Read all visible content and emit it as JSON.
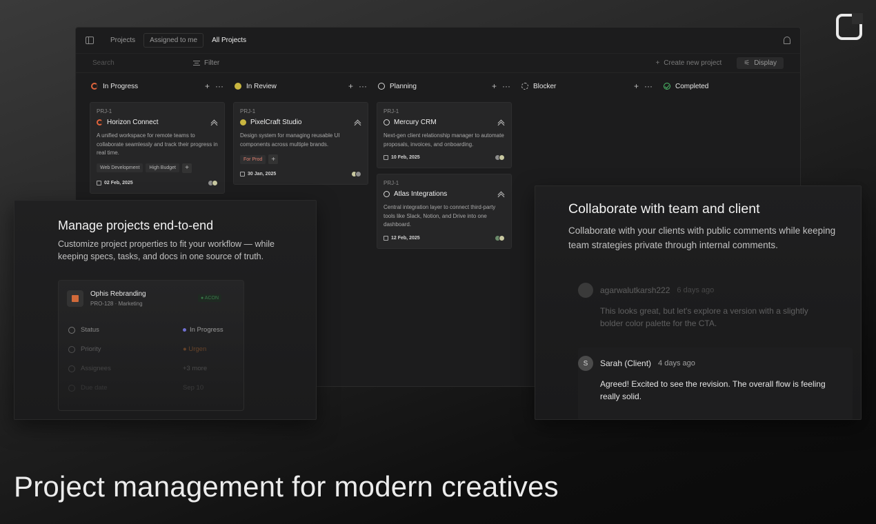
{
  "topbar": {
    "tabs": [
      {
        "label": "Projects"
      },
      {
        "label": "Assigned to me"
      },
      {
        "label": "All Projects"
      }
    ]
  },
  "filterbar": {
    "search_placeholder": "Search",
    "filter_label": "Filter",
    "create_label": "Create new project",
    "display_label": "Display"
  },
  "columns": [
    {
      "name": "In Progress",
      "status": "in-progress"
    },
    {
      "name": "In Review",
      "status": "in-review"
    },
    {
      "name": "Planning",
      "status": "planning"
    },
    {
      "name": "Blocker",
      "status": "blocker"
    },
    {
      "name": "Completed",
      "status": "completed"
    }
  ],
  "cards": {
    "horizon": {
      "id": "PRJ-1",
      "title": "Horizon Connect",
      "desc": "A unified workspace for remote teams to collaborate seamlessly and track their progress in real time.",
      "tags": [
        "Web Development",
        "High Budget"
      ],
      "date": "02 Feb, 2025"
    },
    "pixelcraft": {
      "id": "PRJ-1",
      "title": "PixelCraft Studio",
      "desc": "Design system for managing reusable UI components across multiple brands.",
      "tags": [
        "For Prod"
      ],
      "date": "30 Jan, 2025"
    },
    "mercury": {
      "id": "PRJ-1",
      "title": "Mercury CRM",
      "desc": "Next-gen client relationship manager to automate proposals, invoices, and onboarding.",
      "date": "10 Feb, 2025"
    },
    "atlas": {
      "id": "PRJ-1",
      "title": "Atlas Integrations",
      "desc": "Central integration layer to connect third-party tools like Slack, Notion, and Drive into one dashboard.",
      "date": "12 Feb, 2025"
    }
  },
  "left_panel": {
    "heading": "Manage projects end-to-end",
    "body": "Customize project properties to fit your workflow — while keeping specs, tasks, and docs in one source of truth.",
    "project": {
      "title": "Ophis Rebranding",
      "sub": "PRO-128 · Marketing",
      "badge": "● ACON",
      "props": [
        {
          "label": "Status",
          "value": "In Progress"
        },
        {
          "label": "Priority",
          "value": "● Urgen"
        },
        {
          "label": "Assignees",
          "value": "+3 more"
        },
        {
          "label": "Due date",
          "value": "Sep 10"
        }
      ]
    }
  },
  "right_panel": {
    "heading": "Collaborate with team and client",
    "body": "Collaborate with your clients with public comments while keeping team strategies private through internal comments.",
    "comments": [
      {
        "author": "agarwalutkarsh222",
        "time": "6 days ago",
        "text": "This looks great, but let's explore a version with a slightly bolder color palette for the CTA.",
        "initial": ""
      },
      {
        "author": "Sarah (Client)",
        "time": "4 days ago",
        "text": "Agreed! Excited to see the revision. The overall flow is feeling really solid.",
        "initial": "S"
      }
    ]
  },
  "headline": "Project management for modern creatives",
  "colors": {
    "in_progress": "#e0643c",
    "in_review": "#c9b640",
    "completed": "#4cbf6a",
    "background": "#1c1c1d"
  }
}
